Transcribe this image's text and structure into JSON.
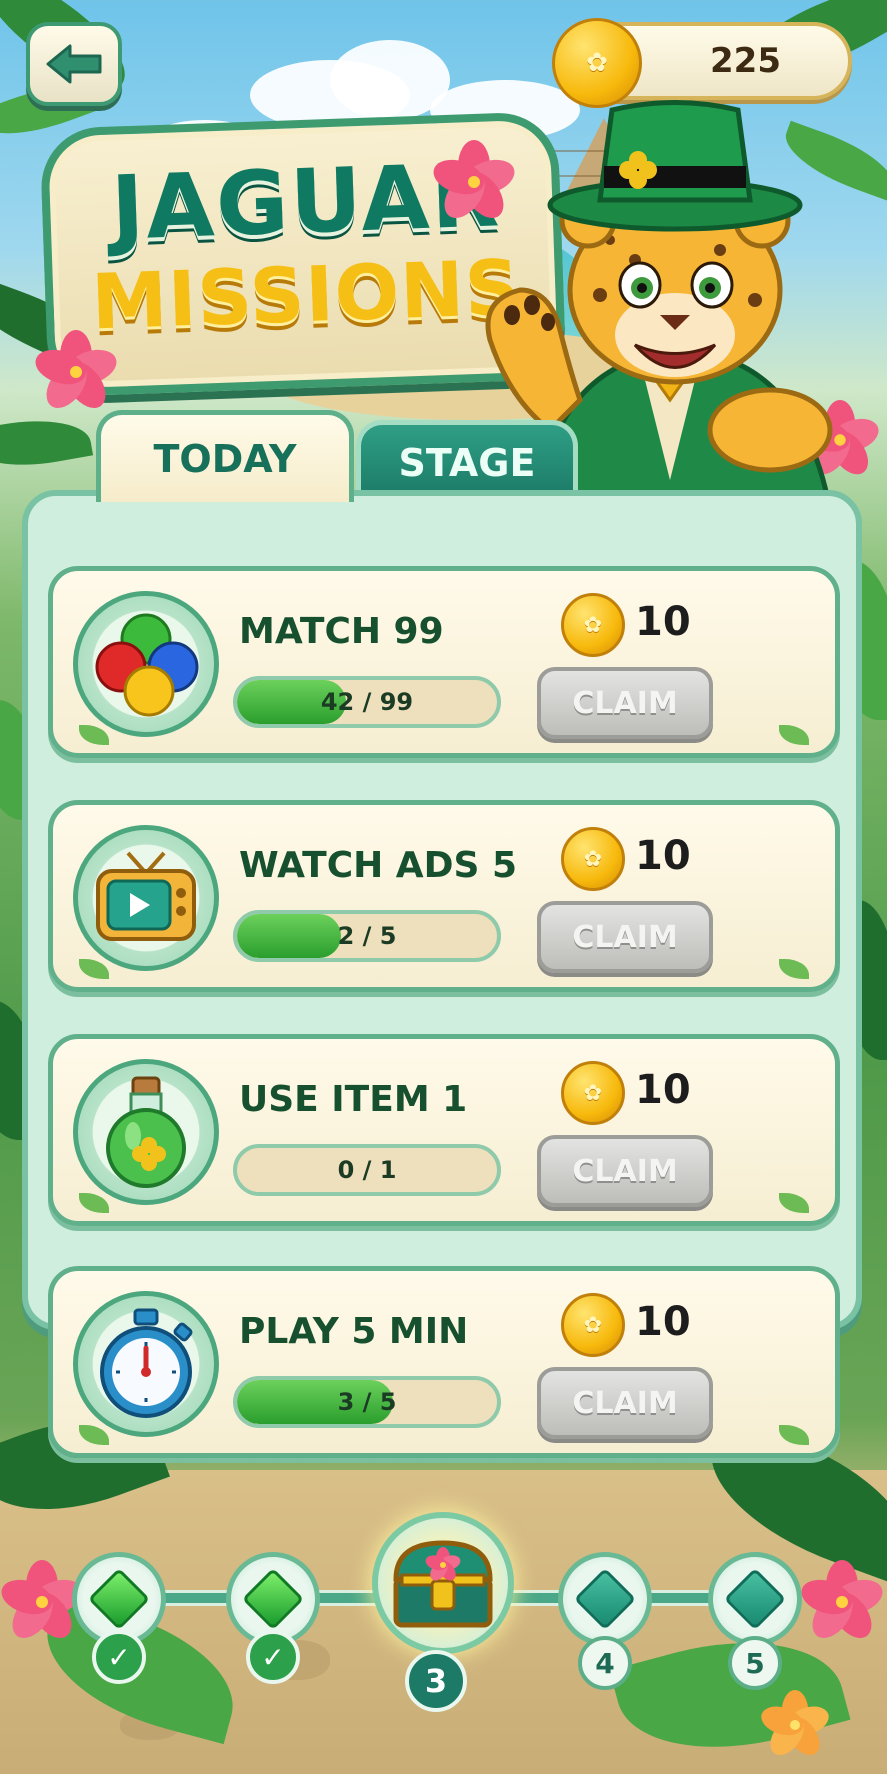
{
  "header": {
    "back_label": "",
    "coins": "225"
  },
  "title": {
    "line1": "JAGUAR",
    "line2": "MISSIONS"
  },
  "tabs": [
    {
      "label": "TODAY",
      "active": true
    },
    {
      "label": "STAGE",
      "active": false
    }
  ],
  "missions": [
    {
      "title": "MATCH 99",
      "progress_text": "42 / 99",
      "progress": 0.42,
      "reward": "10",
      "button": "CLAIM",
      "icon": "colored-balls-icon"
    },
    {
      "title": "WATCH ADS 5",
      "progress_text": "2 / 5",
      "progress": 0.4,
      "reward": "10",
      "button": "CLAIM",
      "icon": "tv-play-icon"
    },
    {
      "title": "USE ITEM 1",
      "progress_text": "0 / 1",
      "progress": 0.0,
      "reward": "10",
      "button": "CLAIM",
      "icon": "potion-bottle-icon"
    },
    {
      "title": "PLAY 5 MIN",
      "progress_text": "3 / 5",
      "progress": 0.6,
      "reward": "10",
      "button": "CLAIM",
      "icon": "stopwatch-icon"
    }
  ],
  "stage_track": [
    {
      "state": "completed",
      "badge": "✓"
    },
    {
      "state": "completed",
      "badge": "✓"
    },
    {
      "state": "current-chest",
      "badge": "3"
    },
    {
      "state": "locked",
      "badge": "4"
    },
    {
      "state": "locked",
      "badge": "5"
    }
  ],
  "colors": {
    "primary_teal": "#1b7a66",
    "progress_green": "#2a9e2d",
    "coin_gold": "#f7b90c",
    "claim_disabled": "#bdbdba"
  }
}
